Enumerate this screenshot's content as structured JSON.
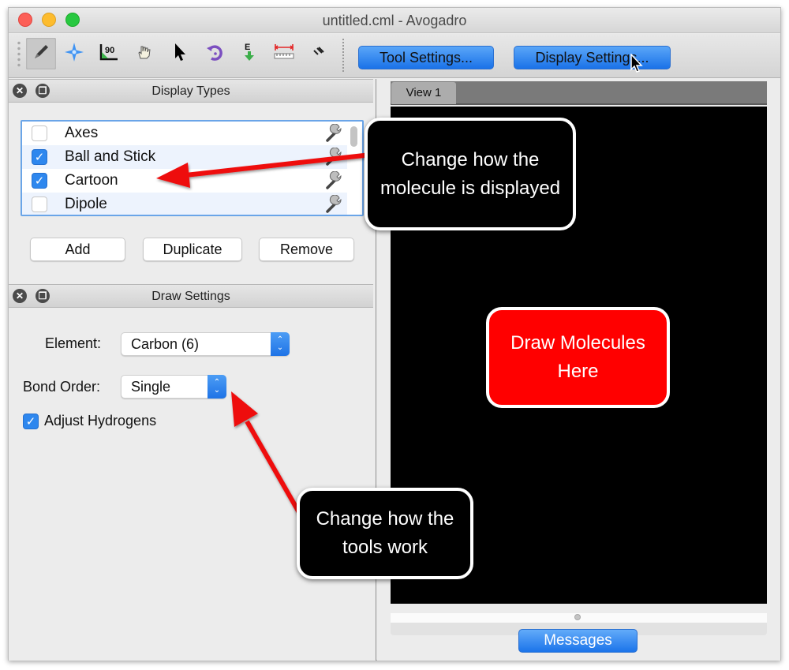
{
  "window": {
    "title": "untitled.cml - Avogadro"
  },
  "toolbar": {
    "tools": [
      {
        "name": "draw-tool",
        "icon": "pencil-icon",
        "active": true
      },
      {
        "name": "navigate-tool",
        "icon": "navigate-star-icon",
        "active": false
      },
      {
        "name": "bond-centric-tool",
        "icon": "angle-90-icon",
        "active": false
      },
      {
        "name": "manipulate-tool",
        "icon": "hand-icon",
        "active": false
      },
      {
        "name": "select-tool",
        "icon": "arrow-cursor-icon",
        "active": false
      },
      {
        "name": "auto-rotate-tool",
        "icon": "rotate-icon",
        "active": false
      },
      {
        "name": "auto-optimize-tool",
        "icon": "energy-optimize-icon",
        "active": false
      },
      {
        "name": "measure-tool",
        "icon": "ruler-icon",
        "active": false
      },
      {
        "name": "align-tool",
        "icon": "align-icon",
        "active": false
      }
    ],
    "tool_settings_label": "Tool Settings...",
    "display_settings_label": "Display Settings..."
  },
  "display_types": {
    "title": "Display Types",
    "items": [
      {
        "label": "Axes",
        "checked": false
      },
      {
        "label": "Ball and Stick",
        "checked": true
      },
      {
        "label": "Cartoon",
        "checked": true
      },
      {
        "label": "Dipole",
        "checked": false
      }
    ],
    "add_label": "Add",
    "duplicate_label": "Duplicate",
    "remove_label": "Remove"
  },
  "draw_settings": {
    "title": "Draw Settings",
    "element_label": "Element:",
    "element_value": "Carbon (6)",
    "bond_order_label": "Bond Order:",
    "bond_order_value": "Single",
    "adjust_hydrogens_label": "Adjust Hydrogens",
    "adjust_hydrogens_checked": true
  },
  "view": {
    "tab_label": "View 1",
    "messages_label": "Messages"
  },
  "annotations": {
    "display_callout": "Change how the molecule is displayed",
    "draw_callout": "Draw Molecules Here",
    "tools_callout": "Change how the tools work"
  },
  "colors": {
    "accent_blue": "#2e87ee",
    "annotation_red": "#ff0000",
    "canvas_bg": "#000000"
  }
}
